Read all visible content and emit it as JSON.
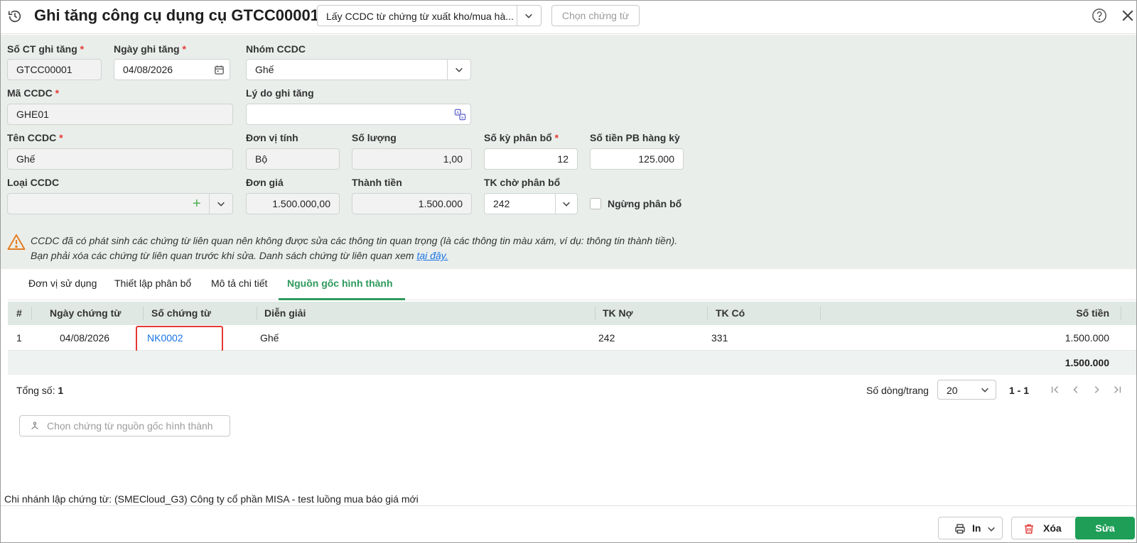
{
  "header": {
    "title": "Ghi tăng công cụ dụng cụ GTCC00001",
    "source_select": "Lấy CCDC từ chứng từ xuất kho/mua hà...",
    "choose_voucher_button": "Chọn chứng từ"
  },
  "form": {
    "so_ct_label": "Số CT ghi tăng",
    "so_ct_value": "GTCC00001",
    "ngay_label": "Ngày ghi tăng",
    "ngay_value": "04/08/2026",
    "nhom_label": "Nhóm CCDC",
    "nhom_value": "Ghế",
    "ma_label": "Mã CCDC",
    "ma_value": "GHE01",
    "ly_do_label": "Lý do ghi tăng",
    "ly_do_value": "",
    "ten_label": "Tên CCDC",
    "ten_value": "Ghế",
    "dvt_label": "Đơn vị tính",
    "dvt_value": "Bộ",
    "so_luong_label": "Số lượng",
    "so_luong_value": "1,00",
    "so_ky_label": "Số kỳ phân bổ",
    "so_ky_value": "12",
    "so_tien_pb_label": "Số tiền PB hàng kỳ",
    "so_tien_pb_value": "125.000",
    "loai_label": "Loại CCDC",
    "loai_value": "",
    "don_gia_label": "Đơn giá",
    "don_gia_value": "1.500.000,00",
    "thanh_tien_label": "Thành tiền",
    "thanh_tien_value": "1.500.000",
    "tk_cho_label": "TK chờ phân bổ",
    "tk_cho_value": "242",
    "ngung_label": "Ngừng phân bổ",
    "required_mark": "*"
  },
  "warning": {
    "line1": "CCDC đã có phát sinh các chứng từ liên quan nên không được sửa các thông tin quan trọng (là các thông tin màu xám, ví dụ: thông tin thành tiền).",
    "line2": "Bạn phải xóa các chứng từ liên quan trước khi sửa. Danh sách chứng từ liên quan xem ",
    "link": "tại đây."
  },
  "tabs": [
    "Đơn vị sử dụng",
    "Thiết lập phân bổ",
    "Mô tả chi tiết",
    "Nguồn gốc hình thành"
  ],
  "table": {
    "columns": [
      "#",
      "Ngày chứng từ",
      "Số chứng từ",
      "Diễn giải",
      "TK Nợ",
      "TK Có",
      "Số tiền"
    ],
    "rows": [
      [
        "1",
        "04/08/2026",
        "NK0002",
        "Ghế",
        "242",
        "331",
        "1.500.000"
      ]
    ],
    "total": "1.500.000"
  },
  "pager": {
    "total_label": "Tổng số:",
    "total_value": "1",
    "rows_per_page_label": "Số dòng/trang",
    "rows_per_page": "20",
    "range": "1 - 1"
  },
  "source_button": "Chọn chứng từ nguồn gốc hình thành",
  "branch": "Chi nhánh lập chứng từ: (SMECloud_G3) Công ty cổ phần MISA - test luồng mua báo giá mới",
  "footer": {
    "print": "In",
    "delete": "Xóa",
    "edit": "Sửa"
  },
  "colors": {
    "accent": "#2e9a5c",
    "primary_button": "#1e9e57",
    "link": "#1a73e8",
    "highlight_box": "#e53935"
  }
}
